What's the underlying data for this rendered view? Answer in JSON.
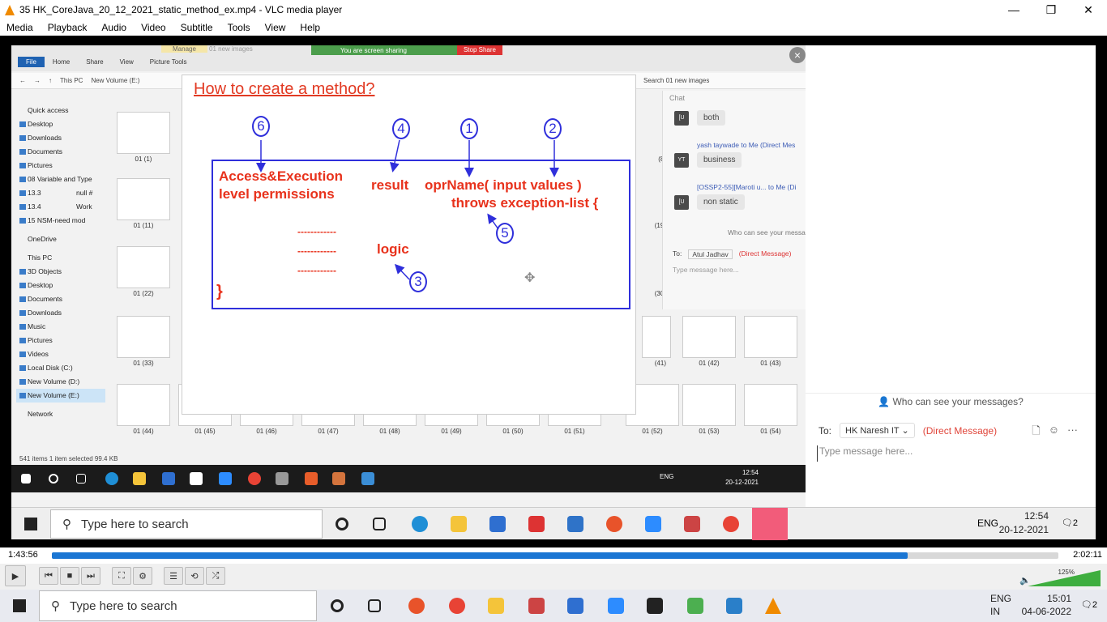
{
  "window": {
    "title": "35 HK_CoreJava_20_12_2021_static_method_ex.mp4 - VLC media player",
    "minimize": "—",
    "maximize": "❐",
    "close": "✕"
  },
  "menu": [
    "Media",
    "Playback",
    "Audio",
    "Video",
    "Subtitle",
    "Tools",
    "View",
    "Help"
  ],
  "explorer": {
    "tabs": [
      "File",
      "Home",
      "Share",
      "View",
      "Picture Tools"
    ],
    "manage_label": "Manage",
    "folder_name": "01 new images",
    "share_text": "You are screen sharing",
    "stop_share": "Stop Share",
    "address": [
      "This PC",
      "New Volume (E:)"
    ],
    "search_text": "Search 01 new images",
    "nav_items": [
      "Quick access",
      "Desktop",
      "Downloads",
      "Documents",
      "Pictures",
      "08 Variable and Type",
      "13.3",
      "13.4",
      "15 NSM-need mod",
      "OneDrive",
      "This PC",
      "3D Objects",
      "Desktop",
      "Documents",
      "Downloads",
      "Music",
      "Pictures",
      "Videos",
      "Local Disk (C:)",
      "New Volume (D:)",
      "New Volume (E:)",
      "Network"
    ],
    "nav_extra": [
      "null #",
      "Work"
    ],
    "thumb_labels": [
      "01 (1)",
      "01 (11)",
      "01 (22)",
      "01 (33)",
      "01 (44)",
      "01 (45)",
      "01 (46)",
      "01 (47)",
      "01 (48)",
      "01 (49)",
      "01 (50)",
      "01 (51)",
      "01 (52)",
      "01 (53)",
      "01 (54)",
      "01 (42)",
      "01 (43)",
      "(8)",
      "(19)",
      "(30)",
      "(41)"
    ],
    "status": "541 items     1 item selected  99.4 KB"
  },
  "rdp_taskbar": {
    "time": "12:54",
    "date": "20-12-2021",
    "lang": "ENG"
  },
  "inner_chat": {
    "header": "Chat",
    "messages": [
      {
        "avatar": "[U",
        "sender": "",
        "text": "both"
      },
      {
        "avatar": "YT",
        "sender": "yash taywade to Me (Direct Mes",
        "text": "business"
      },
      {
        "avatar": "[U",
        "sender": "[OSSP2-55][Maroti u... to Me (Di",
        "text": "non static"
      }
    ],
    "who": "Who can see your messag",
    "to_label": "To:",
    "recipient": "Atul Jadhav",
    "dm": "(Direct Message)",
    "placeholder": "Type message here..."
  },
  "slide": {
    "title": "How to create a method?",
    "access": "Access&Execution",
    "access2": "level permissions",
    "result": "result",
    "oprname": "oprName( input values )",
    "throws": "throws exception-list {",
    "logic": "logic",
    "close_brace": "}",
    "dashes": "------------",
    "numbers": [
      "6",
      "4",
      "1",
      "2",
      "5",
      "3"
    ]
  },
  "right_chat": {
    "who": "Who can see your messages?",
    "to_label": "To:",
    "recipient": "HK Naresh IT",
    "dm": "(Direct Message)",
    "placeholder": "Type message here..."
  },
  "video_taskbar": {
    "search": "Type here to search",
    "time": "12:54",
    "date": "20-12-2021",
    "lang": "ENG",
    "notif": "2"
  },
  "player": {
    "current": "1:43:56",
    "total": "2:02:11",
    "progress": 0.85,
    "volume": "125%"
  },
  "host_taskbar": {
    "search": "Type here to search",
    "lang": "ENG",
    "region": "IN",
    "time": "15:01",
    "date": "04-06-2022",
    "notif": "2"
  }
}
